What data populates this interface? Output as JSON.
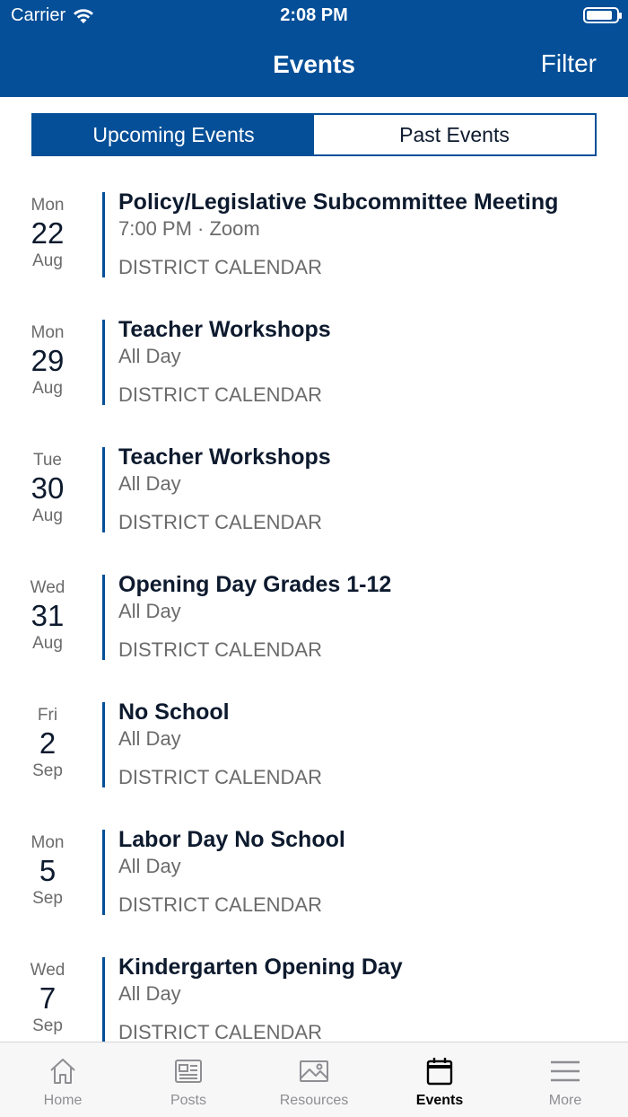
{
  "status_bar": {
    "carrier": "Carrier",
    "time": "2:08 PM",
    "battery_level": 0.9
  },
  "nav": {
    "title": "Events",
    "filter_label": "Filter"
  },
  "segmented": {
    "upcoming_label": "Upcoming Events",
    "past_label": "Past Events",
    "selected": "upcoming"
  },
  "events": [
    {
      "dow": "Mon",
      "day": "22",
      "month": "Aug",
      "title": "Policy/Legislative Subcommittee Meeting",
      "when": "7:00 PM · Zoom",
      "calendar": "DISTRICT CALENDAR"
    },
    {
      "dow": "Mon",
      "day": "29",
      "month": "Aug",
      "title": "Teacher Workshops",
      "when": "All Day",
      "calendar": "DISTRICT CALENDAR"
    },
    {
      "dow": "Tue",
      "day": "30",
      "month": "Aug",
      "title": "Teacher Workshops",
      "when": "All Day",
      "calendar": "DISTRICT CALENDAR"
    },
    {
      "dow": "Wed",
      "day": "31",
      "month": "Aug",
      "title": "Opening Day Grades 1-12",
      "when": "All Day",
      "calendar": "DISTRICT CALENDAR"
    },
    {
      "dow": "Fri",
      "day": "2",
      "month": "Sep",
      "title": "No School",
      "when": "All Day",
      "calendar": "DISTRICT CALENDAR"
    },
    {
      "dow": "Mon",
      "day": "5",
      "month": "Sep",
      "title": "Labor Day No School",
      "when": "All Day",
      "calendar": "DISTRICT CALENDAR"
    },
    {
      "dow": "Wed",
      "day": "7",
      "month": "Sep",
      "title": "Kindergarten Opening Day",
      "when": "All Day",
      "calendar": "DISTRICT CALENDAR"
    }
  ],
  "tabbar": {
    "items": [
      {
        "label": "Home",
        "icon": "home-icon"
      },
      {
        "label": "Posts",
        "icon": "posts-icon"
      },
      {
        "label": "Resources",
        "icon": "resources-icon"
      },
      {
        "label": "Events",
        "icon": "events-icon",
        "selected": true
      },
      {
        "label": "More",
        "icon": "more-icon"
      }
    ]
  },
  "colors": {
    "brand": "#044f98",
    "text_dark": "#0d1a2e",
    "text_muted": "#6b6b6b",
    "tab_inactive": "#8e8e93"
  }
}
